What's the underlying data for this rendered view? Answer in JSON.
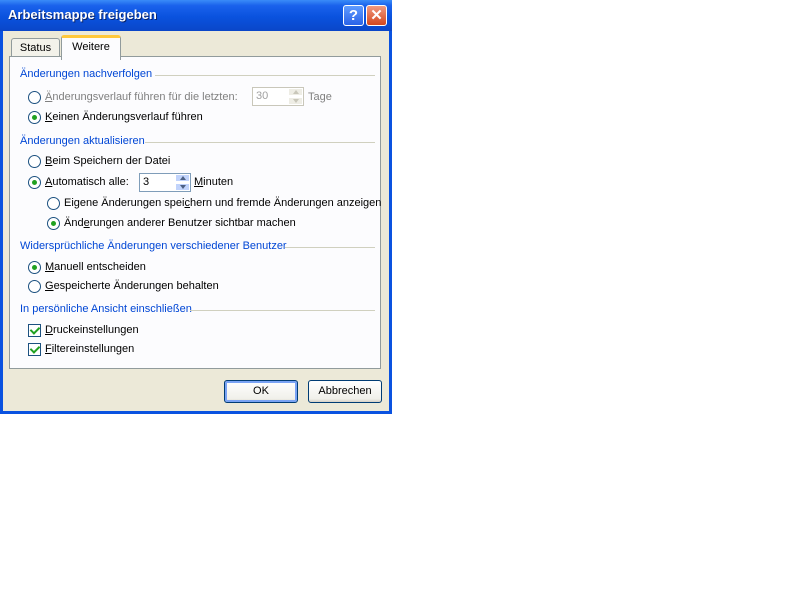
{
  "window": {
    "title": "Arbeitsmappe freigeben",
    "help_glyph": "?",
    "close_glyph": "✕"
  },
  "tabs": [
    {
      "label": "Status",
      "active": false
    },
    {
      "label": "Weitere",
      "active": true
    }
  ],
  "groups": {
    "track": {
      "title": "Änderungen nachverfolgen",
      "history_days": {
        "label_u": "Ä",
        "label_rest": "nderungsverlauf führen für die letzten:",
        "value": "30",
        "unit": "Tage",
        "selected": false
      },
      "no_history": {
        "label_u": "K",
        "label_rest": "einen Änderungsverlauf führen",
        "selected": true
      }
    },
    "update": {
      "title": "Änderungen aktualisieren",
      "on_save": {
        "label_u": "B",
        "label_rest": "eim Speichern der Datei",
        "selected": false
      },
      "auto": {
        "label_u": "A",
        "label_rest": "utomatisch alle:",
        "value": "3",
        "unit_u": "M",
        "unit_rest": "inuten",
        "selected": true
      },
      "save_and_show": {
        "label_pre": "Eigene Änderungen spei",
        "label_u": "c",
        "label_post": "hern und fremde Änderungen anzeigen",
        "selected": false
      },
      "show_others": {
        "label_pre": "Änd",
        "label_u": "e",
        "label_post": "rungen anderer Benutzer sichtbar machen",
        "selected": true
      }
    },
    "conflict": {
      "title": "Widersprüchliche Änderungen verschiedener Benutzer",
      "manual": {
        "label_u": "M",
        "label_rest": "anuell entscheiden",
        "selected": true
      },
      "keep_saved": {
        "label_u": "G",
        "label_rest": "espeicherte Änderungen behalten",
        "selected": false
      }
    },
    "view": {
      "title": "In persönliche Ansicht einschließen",
      "print": {
        "label_u": "D",
        "label_rest": "ruckeinstellungen",
        "checked": true
      },
      "filter": {
        "label_u": "F",
        "label_rest": "iltereinstellungen",
        "checked": true
      }
    }
  },
  "buttons": {
    "ok": "OK",
    "cancel": "Abbrechen"
  }
}
